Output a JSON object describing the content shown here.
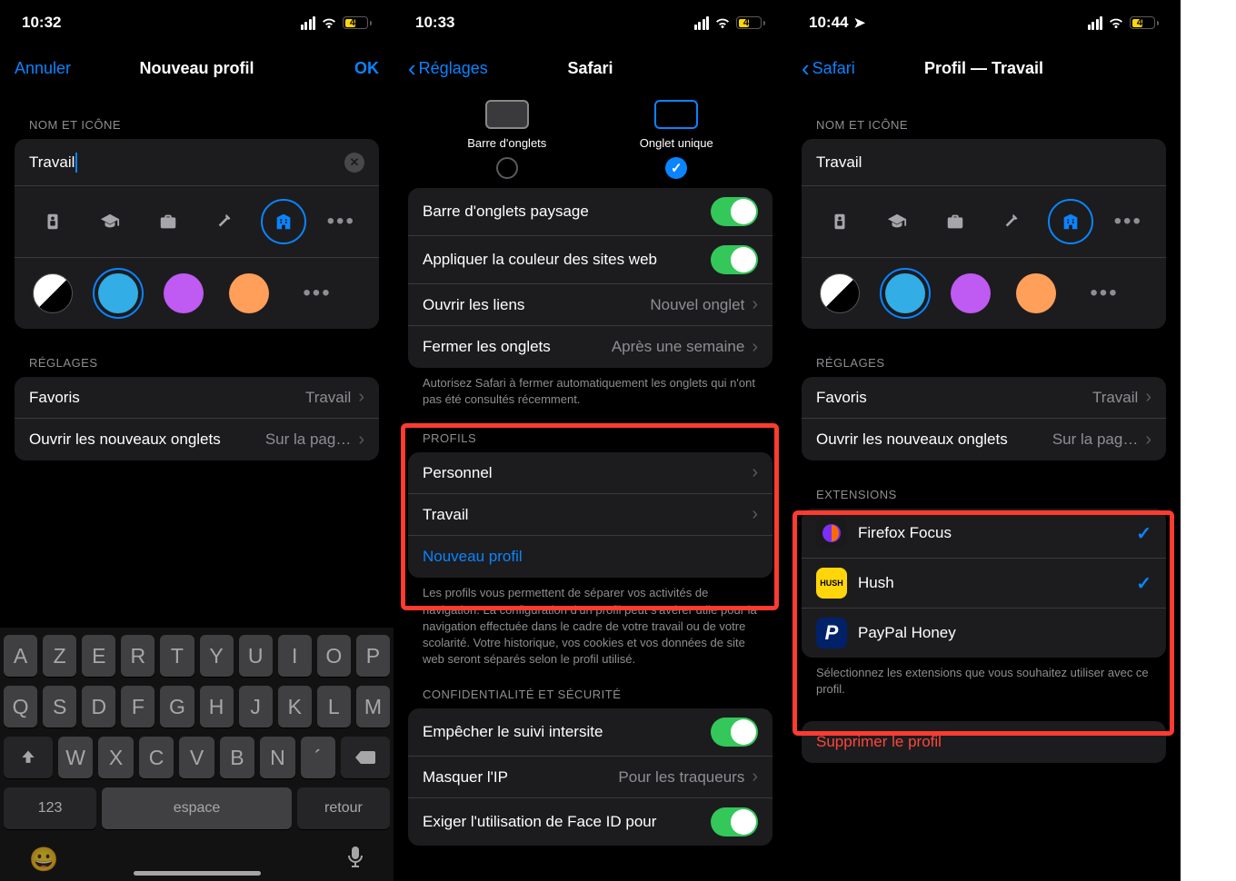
{
  "screen1": {
    "time": "10:32",
    "battery": "45",
    "nav_cancel": "Annuler",
    "nav_title": "Nouveau profil",
    "nav_ok": "OK",
    "section_name_icon": "NOM ET ICÔNE",
    "input_value": "Travail",
    "section_settings": "RÉGLAGES",
    "favoris_label": "Favoris",
    "favoris_value": "Travail",
    "newtabs_label": "Ouvrir les nouveaux onglets",
    "newtabs_value": "Sur la pag…",
    "kb_r1": [
      "A",
      "Z",
      "E",
      "R",
      "T",
      "Y",
      "U",
      "I",
      "O",
      "P"
    ],
    "kb_r2": [
      "Q",
      "S",
      "D",
      "F",
      "G",
      "H",
      "J",
      "K",
      "L",
      "M"
    ],
    "kb_r3": [
      "W",
      "X",
      "C",
      "V",
      "B",
      "N",
      "´"
    ],
    "kb_123": "123",
    "kb_space": "espace",
    "kb_return": "retour"
  },
  "screen2": {
    "time": "10:33",
    "battery": "45",
    "nav_back": "Réglages",
    "nav_title": "Safari",
    "tab_bar_label": "Barre d'onglets",
    "single_tab_label": "Onglet unique",
    "row_landscape": "Barre d'onglets paysage",
    "row_color": "Appliquer la couleur des sites web",
    "row_open": "Ouvrir les liens",
    "row_open_val": "Nouvel onglet",
    "row_close": "Fermer les onglets",
    "row_close_val": "Après une semaine",
    "footer_close": "Autorisez Safari à fermer automatiquement les onglets qui n'ont pas été consultés récemment.",
    "section_profils": "PROFILS",
    "profile_personal": "Personnel",
    "profile_work": "Travail",
    "new_profile": "Nouveau profil",
    "footer_profils": "Les profils vous permettent de séparer vos activités de navigation. La configuration d'un profil peut s'avérer utile pour la navigation effectuée dans le cadre de votre travail ou de votre scolarité. Votre historique, vos cookies et vos données de site web seront séparés selon le profil utilisé.",
    "section_privacy": "CONFIDENTIALITÉ ET SÉCURITÉ",
    "row_track": "Empêcher le suivi intersite",
    "row_ip": "Masquer l'IP",
    "row_ip_val": "Pour les traqueurs",
    "row_faceid": "Exiger l'utilisation de Face ID pour"
  },
  "screen3": {
    "time": "10:44",
    "battery": "43",
    "nav_back": "Safari",
    "nav_title": "Profil — Travail",
    "section_name_icon": "NOM ET ICÔNE",
    "input_value": "Travail",
    "section_settings": "RÉGLAGES",
    "favoris_label": "Favoris",
    "favoris_value": "Travail",
    "newtabs_label": "Ouvrir les nouveaux onglets",
    "newtabs_value": "Sur la pag…",
    "section_ext": "EXTENSIONS",
    "ext1": "Firefox Focus",
    "ext2": "Hush",
    "ext3": "PayPal Honey",
    "footer_ext": "Sélectionnez les extensions que vous souhaitez utiliser avec ce profil.",
    "delete": "Supprimer le profil"
  },
  "colors": {
    "blue": "#32ade6",
    "purple": "#bf5af2",
    "orange": "#ff9f5a"
  }
}
